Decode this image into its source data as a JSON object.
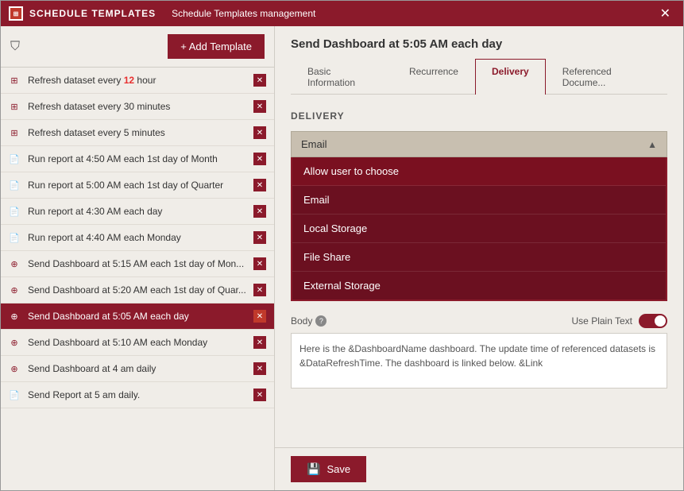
{
  "titleBar": {
    "appName": "SCHEDULE TEMPLATES",
    "subtitle": "Schedule Templates management",
    "closeLabel": "✕"
  },
  "leftPanel": {
    "addTemplateLabel": "+ Add Template",
    "templates": [
      {
        "id": 1,
        "icon": "grid",
        "text": "Refresh dataset every 12 hour",
        "highlight": "12",
        "active": false
      },
      {
        "id": 2,
        "icon": "grid",
        "text": "Refresh dataset every 30 minutes",
        "highlight": "",
        "active": false
      },
      {
        "id": 3,
        "icon": "grid",
        "text": "Refresh dataset every 5 minutes",
        "highlight": "",
        "active": false
      },
      {
        "id": 4,
        "icon": "report",
        "text": "Run report at 4:50 AM each 1st day of Month",
        "highlight": "",
        "active": false
      },
      {
        "id": 5,
        "icon": "report",
        "text": "Run report at 5:00 AM each 1st day of Quarter",
        "highlight": "",
        "active": false
      },
      {
        "id": 6,
        "icon": "report",
        "text": "Run report at 4:30 AM each day",
        "highlight": "",
        "active": false
      },
      {
        "id": 7,
        "icon": "report",
        "text": "Run report at 4:40 AM each Monday",
        "highlight": "",
        "active": false
      },
      {
        "id": 8,
        "icon": "dashboard",
        "text": "Send Dashboard at 5:15 AM each 1st day of Mon...",
        "highlight": "",
        "active": false
      },
      {
        "id": 9,
        "icon": "dashboard",
        "text": "Send Dashboard at 5:20 AM each 1st day of Quar...",
        "highlight": "",
        "active": false
      },
      {
        "id": 10,
        "icon": "dashboard",
        "text": "Send Dashboard at 5:05 AM each day",
        "highlight": "",
        "active": true
      },
      {
        "id": 11,
        "icon": "dashboard",
        "text": "Send Dashboard at 5:10 AM each Monday",
        "highlight": "",
        "active": false
      },
      {
        "id": 12,
        "icon": "dashboard",
        "text": "Send Dashboard at 4 am daily",
        "highlight": "",
        "active": false
      },
      {
        "id": 13,
        "icon": "report",
        "text": "Send Report at 5 am daily.",
        "highlight": "",
        "active": false
      }
    ]
  },
  "rightPanel": {
    "title": "Send Dashboard at 5:05 AM each day",
    "tabs": [
      {
        "id": "basic",
        "label": "Basic Information",
        "active": false
      },
      {
        "id": "recurrence",
        "label": "Recurrence",
        "active": false
      },
      {
        "id": "delivery",
        "label": "Delivery",
        "active": true
      },
      {
        "id": "referenced",
        "label": "Referenced Docume...",
        "active": false
      }
    ],
    "delivery": {
      "sectionTitle": "DELIVERY",
      "dropdownSelected": "Email",
      "options": [
        {
          "label": "Allow user to choose"
        },
        {
          "label": "Email"
        },
        {
          "label": "Local Storage"
        },
        {
          "label": "File Share"
        },
        {
          "label": "External Storage"
        }
      ]
    },
    "body": {
      "label": "Body",
      "usePlainTextLabel": "Use Plain Text",
      "bodyText": "Here is the &DashboardName dashboard. The update time of referenced datasets is &DataRefreshTime. The dashboard is linked below. &Link"
    },
    "saveLabel": "Save"
  }
}
